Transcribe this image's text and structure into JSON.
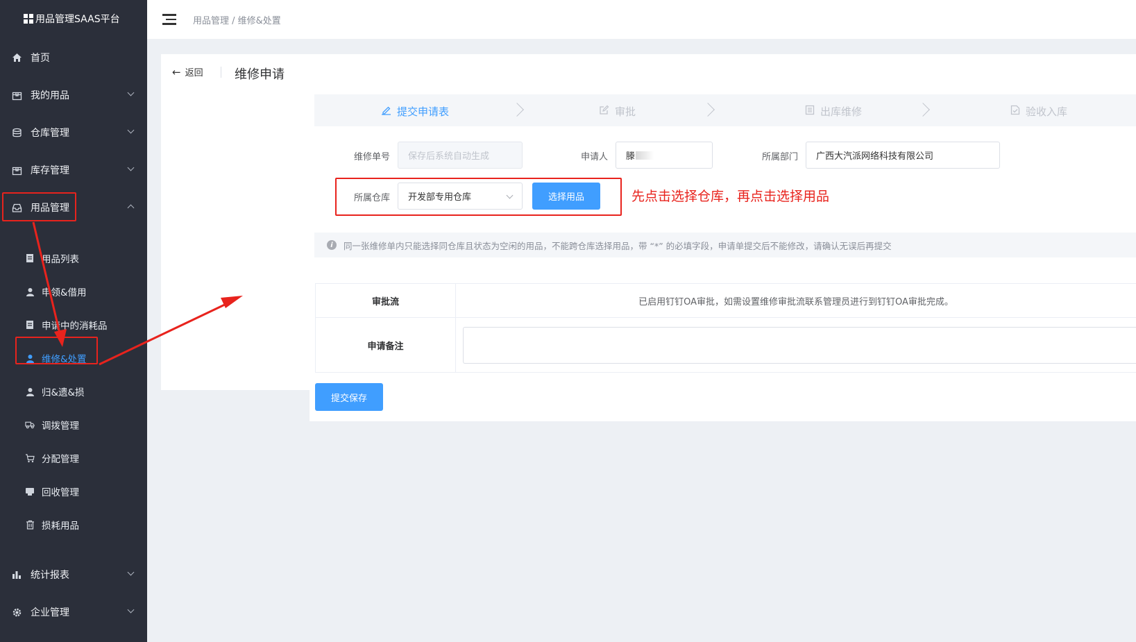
{
  "brand": {
    "title": "用品管理SAAS平台"
  },
  "sidebar": {
    "items": [
      {
        "label": "首页",
        "icon": "home-icon",
        "expandable": false
      },
      {
        "label": "我的用品",
        "icon": "box-icon",
        "expandable": true
      },
      {
        "label": "仓库管理",
        "icon": "database-icon",
        "expandable": true
      },
      {
        "label": "库存管理",
        "icon": "box-icon",
        "expandable": true
      },
      {
        "label": "用品管理",
        "icon": "inbox-icon",
        "expandable": true,
        "expanded": true
      },
      {
        "label": "统计报表",
        "icon": "bar-chart-icon",
        "expandable": true
      },
      {
        "label": "企业管理",
        "icon": "gear-icon",
        "expandable": true
      }
    ],
    "sub_items": [
      {
        "label": "用品列表",
        "icon": "document-icon"
      },
      {
        "label": "申领&借用",
        "icon": "user-icon"
      },
      {
        "label": "申请中的消耗品",
        "icon": "document-icon"
      },
      {
        "label": "维修&处置",
        "icon": "user-icon",
        "active": true
      },
      {
        "label": "归&遗&损",
        "icon": "user-icon"
      },
      {
        "label": "调拨管理",
        "icon": "truck-icon"
      },
      {
        "label": "分配管理",
        "icon": "cart-icon"
      },
      {
        "label": "回收管理",
        "icon": "recycle-icon"
      },
      {
        "label": "损耗用品",
        "icon": "trash-icon"
      }
    ]
  },
  "topbar": {
    "breadcrumb": "用品管理 / 维修&处置"
  },
  "page": {
    "back_label": "返回",
    "title": "维修申请"
  },
  "steps": [
    {
      "label": "提交申请表",
      "icon": "edit-icon",
      "active": true
    },
    {
      "label": "审批",
      "icon": "edit-square-icon",
      "active": false
    },
    {
      "label": "出库维修",
      "icon": "list-icon",
      "active": false
    },
    {
      "label": "验收入库",
      "icon": "file-check-icon",
      "active": false
    }
  ],
  "form": {
    "repair_no_label": "维修单号",
    "repair_no_placeholder": "保存后系统自动生成",
    "applicant_label": "申请人",
    "applicant_value": "滕",
    "dept_label": "所属部门",
    "dept_value": "广西大汽派网络科技有限公司",
    "warehouse_label": "所属仓库",
    "warehouse_value": "开发部专用仓库",
    "select_goods_button": "选择用品"
  },
  "annotation": "先点击选择仓库，再点击选择用品",
  "notice": "同一张维修单内只能选择同仓库且状态为空闲的用品，不能跨仓库选择用品，带 “*” 的必填字段，申请单提交后不能修改，请确认无误后再提交",
  "approval": {
    "flow_label": "审批流",
    "flow_text": "已启用钉钉OA审批，如需设置维修审批流联系管理员进行到钉钉OA审批完成。",
    "remark_label": "申请备注"
  },
  "submit_button": "提交保存",
  "colors": {
    "accent": "#409eff",
    "sidebar_bg": "#2b2f3a",
    "highlight": "#e8231d"
  }
}
